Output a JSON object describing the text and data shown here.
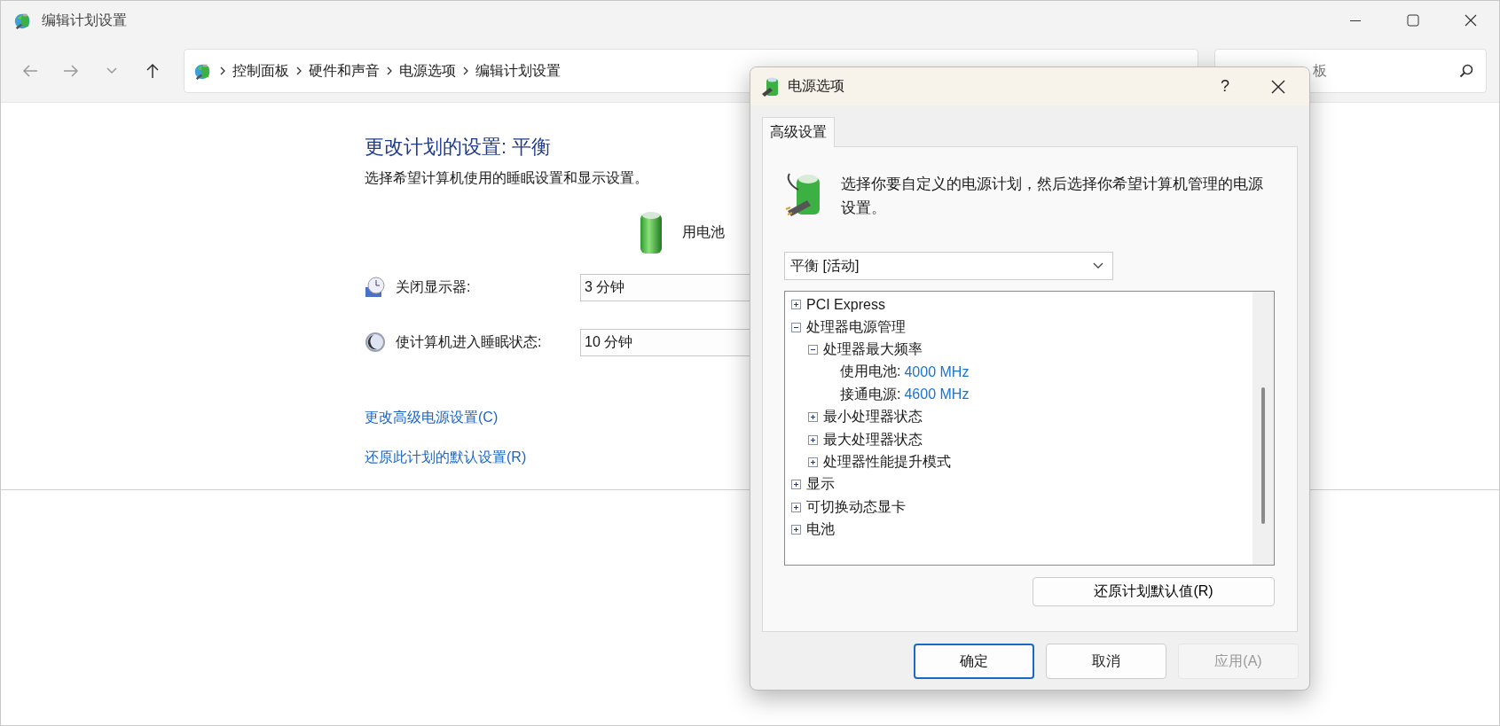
{
  "main_window": {
    "title": "编辑计划设置",
    "breadcrumbs": [
      "控制面板",
      "硬件和声音",
      "电源选项",
      "编辑计划设置"
    ],
    "search": {
      "placeholder": "板"
    },
    "heading": "更改计划的设置: 平衡",
    "subtitle": "选择希望计算机使用的睡眠设置和显示设置。",
    "column_header": "用电池",
    "settings": [
      {
        "kind": "display",
        "label": "关闭显示器:",
        "value": "3 分钟"
      },
      {
        "kind": "sleep",
        "label": "使计算机进入睡眠状态:",
        "value": "10 分钟"
      }
    ],
    "links": [
      "更改高级电源设置(C)",
      "还原此计划的默认设置(R)"
    ]
  },
  "dialog": {
    "title": "电源选项",
    "help": "?",
    "tabs": [
      {
        "label": "高级设置",
        "selected": true
      }
    ],
    "description": "选择你要自定义的电源计划，然后选择你希望计算机管理的电源设置。",
    "plan_dropdown": {
      "value": "平衡 [活动]"
    },
    "tree": [
      {
        "kind": "group",
        "label": "PCI Express",
        "expanded": false
      },
      {
        "kind": "group",
        "label": "处理器电源管理",
        "expanded": true,
        "children": [
          {
            "kind": "group",
            "label": "处理器最大频率",
            "expanded": true,
            "children": [
              {
                "kind": "setting",
                "label": "使用电池:",
                "value": "4000 MHz"
              },
              {
                "kind": "setting",
                "label": "接通电源:",
                "value": "4600 MHz"
              }
            ]
          },
          {
            "kind": "group",
            "label": "最小处理器状态",
            "expanded": false
          },
          {
            "kind": "group",
            "label": "最大处理器状态",
            "expanded": false
          },
          {
            "kind": "group",
            "label": "处理器性能提升模式",
            "expanded": false
          }
        ]
      },
      {
        "kind": "group",
        "label": "显示",
        "expanded": false
      },
      {
        "kind": "group",
        "label": "可切换动态显卡",
        "expanded": false
      },
      {
        "kind": "group",
        "label": "电池",
        "expanded": false
      }
    ],
    "restore_button": "还原计划默认值(R)",
    "buttons": [
      {
        "label": "确定",
        "default": true,
        "disabled": false
      },
      {
        "label": "取消",
        "default": false,
        "disabled": false
      },
      {
        "label": "应用(A)",
        "default": false,
        "disabled": true
      }
    ]
  }
}
